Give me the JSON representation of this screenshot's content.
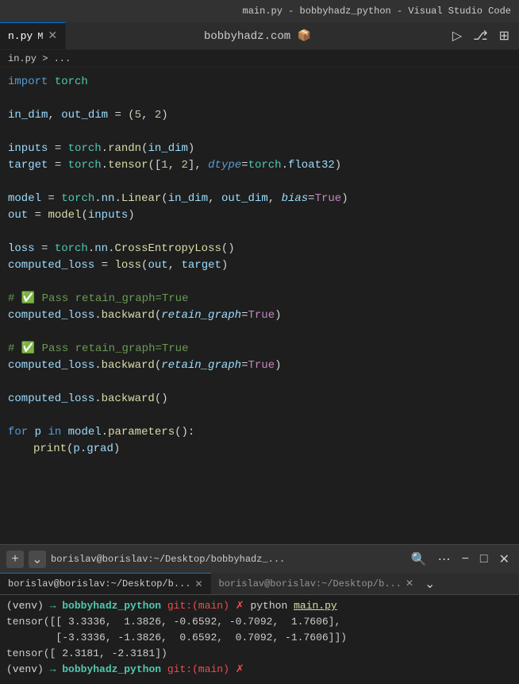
{
  "titleBar": {
    "text": "main.py - bobbyhadz_python - Visual Studio Code"
  },
  "tabBar": {
    "tabs": [
      {
        "label": "n.py",
        "modified": "M",
        "active": true
      },
      {
        "label": "✕",
        "active": false
      }
    ],
    "editorTitle": "bobbyhadz.com 📦"
  },
  "breadcrumb": {
    "path": "in.py > ..."
  },
  "editor": {
    "lines": []
  },
  "terminal": {
    "toolbar": {
      "addLabel": "+",
      "dropLabel": "⌄",
      "path": "borislav@borislav:~/Desktop/bobbyhadz_...",
      "searchLabel": "🔍",
      "moreLabel": "⋯",
      "minimizeLabel": "−",
      "maximizeLabel": "□",
      "closeLabel": "✕"
    },
    "tabs": [
      {
        "label": "borislav@borislav:~/Desktop/b...",
        "active": true
      },
      {
        "label": "borislav@borislav:~/Desktop/b...",
        "active": false
      }
    ],
    "dropdownLabel": "⌄",
    "output": [
      "(venv) → bobbyhadz_python git:(main) ✗ python main.py",
      "tensor([[ 3.3336,  1.3826, -0.6592, -0.7092,  1.7606],",
      "        [-3.3336, -1.3826,  0.6592,  0.7092, -1.7606]])",
      "tensor([ 2.3181, -2.3181])",
      "(venv) → bobbyhadz_python git:(main) ✗"
    ]
  }
}
